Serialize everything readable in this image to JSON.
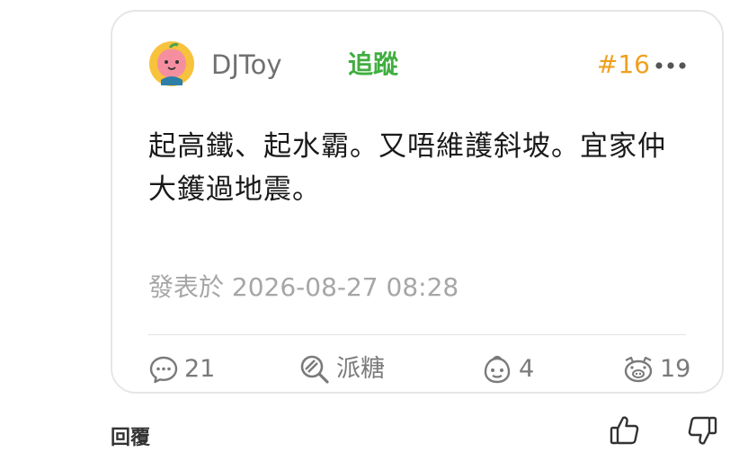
{
  "post": {
    "username": "DJToy",
    "follow_label": "追蹤",
    "floor": "#16",
    "content": "起高鐵、起水霸。又唔維護斜坡。宜家仲大鑊過地震。",
    "posted_at": "發表於 2026-08-27 08:28"
  },
  "actions": {
    "comments_count": "21",
    "candy_label": "派糖",
    "reaction_count": "4",
    "pig_count": "19"
  },
  "footer": {
    "reply_label": "回覆"
  },
  "colors": {
    "follow": "#3fae3f",
    "floor": "#f0a01e",
    "muted": "#a6a6a6",
    "icon": "#7a7a7a"
  },
  "icons": {
    "avatar": "peach-character-avatar",
    "more": "more-dots-icon",
    "comment": "comment-bubble-icon",
    "candy": "candy-magnifier-icon",
    "reaction": "face-icon",
    "pig": "pig-icon",
    "like": "thumbs-up-icon",
    "dislike": "thumbs-down-icon"
  }
}
